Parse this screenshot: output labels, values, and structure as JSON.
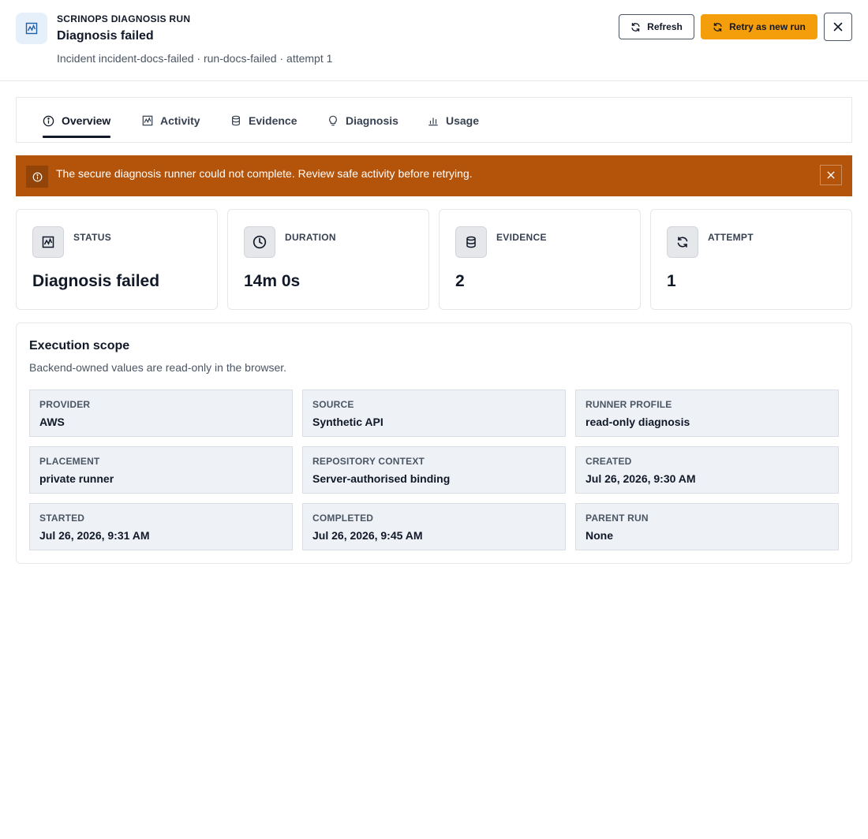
{
  "header": {
    "eyebrow": "SCRINOPS DIAGNOSIS RUN",
    "title": "Diagnosis failed",
    "subtitle": "Incident incident-docs-failed · run-docs-failed · attempt 1",
    "icon": "activity-chart-icon",
    "refresh_label": "Refresh",
    "retry_label": "Retry as new run",
    "close_icon": "close-icon",
    "accent_color": "#f59e0b"
  },
  "tabs": [
    {
      "label": "Overview",
      "icon": "info-icon",
      "active": true
    },
    {
      "label": "Activity",
      "icon": "activity-chart-icon",
      "active": false
    },
    {
      "label": "Evidence",
      "icon": "database-icon",
      "active": false
    },
    {
      "label": "Diagnosis",
      "icon": "lightbulb-icon",
      "active": false
    },
    {
      "label": "Usage",
      "icon": "bar-chart-icon",
      "active": false
    }
  ],
  "alert": {
    "text": "The secure diagnosis runner could not complete. Review safe activity before retrying.",
    "background": "#b4530a",
    "icon": "info-icon"
  },
  "stats": [
    {
      "label": "STATUS",
      "value": "Diagnosis failed",
      "icon": "activity-chart-icon"
    },
    {
      "label": "DURATION",
      "value": "14m 0s",
      "icon": "clock-icon"
    },
    {
      "label": "EVIDENCE",
      "value": "2",
      "icon": "database-icon"
    },
    {
      "label": "ATTEMPT",
      "value": "1",
      "icon": "refresh-icon"
    }
  ],
  "scope": {
    "title": "Execution scope",
    "description": "Backend-owned values are read-only in the browser.",
    "fields": [
      {
        "label": "PROVIDER",
        "value": "AWS"
      },
      {
        "label": "SOURCE",
        "value": "Synthetic API"
      },
      {
        "label": "RUNNER PROFILE",
        "value": "read-only diagnosis"
      },
      {
        "label": "PLACEMENT",
        "value": "private runner"
      },
      {
        "label": "REPOSITORY CONTEXT",
        "value": "Server-authorised binding"
      },
      {
        "label": "CREATED",
        "value": "Jul 26, 2026, 9:30 AM"
      },
      {
        "label": "STARTED",
        "value": "Jul 26, 2026, 9:31 AM"
      },
      {
        "label": "COMPLETED",
        "value": "Jul 26, 2026, 9:45 AM"
      },
      {
        "label": "PARENT RUN",
        "value": "None"
      }
    ]
  }
}
